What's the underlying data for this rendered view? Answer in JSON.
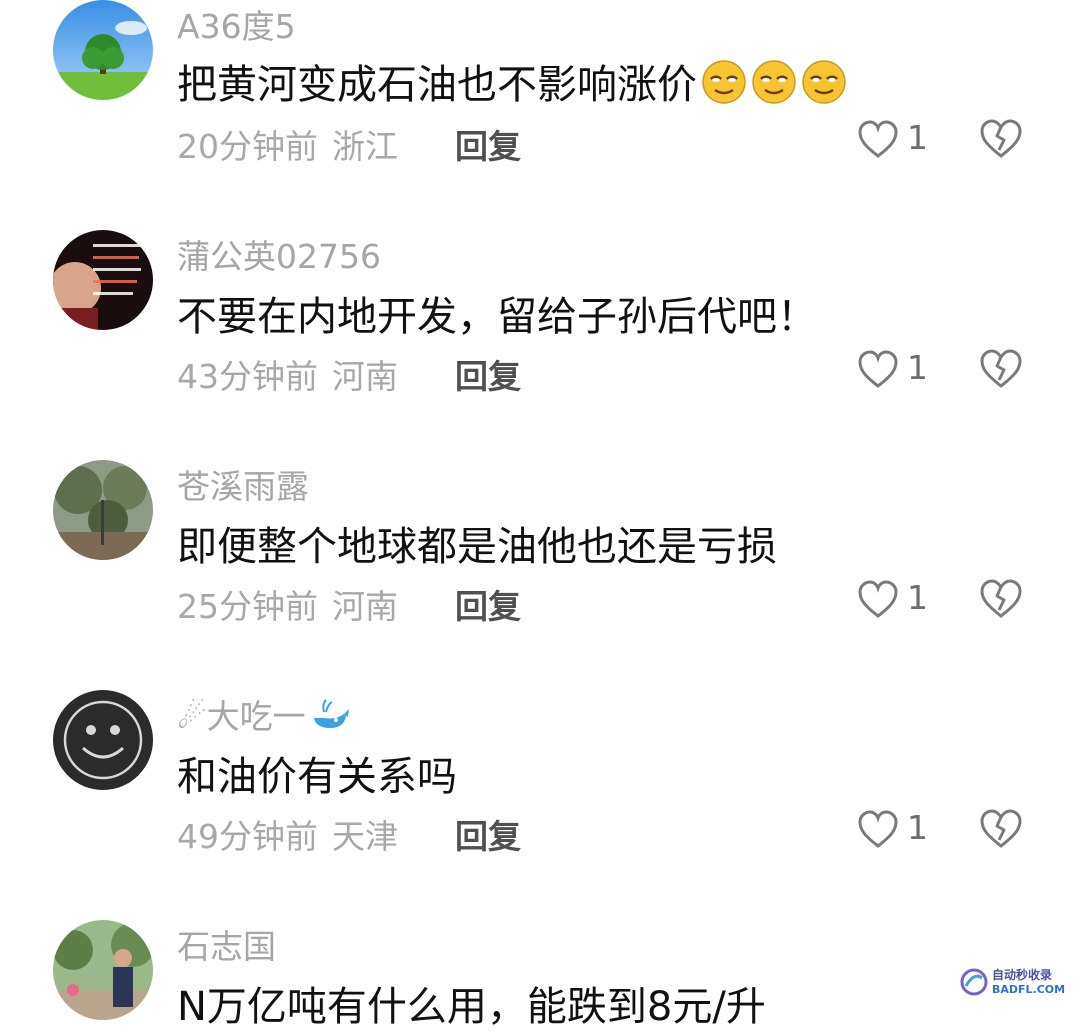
{
  "reply_label": "回复",
  "colors": {
    "username": "#a6a6a6",
    "body": "#111111",
    "meta": "#a8a8a8"
  },
  "comments": [
    {
      "username": "A36度5",
      "text": "把黄河变成石油也不影响涨价",
      "emoji": [
        "smirk-emoji",
        "smirk-emoji",
        "smirk-emoji"
      ],
      "time": "20分钟前",
      "location": "浙江",
      "likes": "1",
      "avatar": "tree-landscape"
    },
    {
      "username": "蒲公英02756",
      "text": "不要在内地开发，留给子孙后代吧！",
      "time": "43分钟前",
      "location": "河南",
      "likes": "1",
      "avatar": "person-with-text"
    },
    {
      "username": "苍溪雨露",
      "text": "即便整个地球都是油他也还是亏损",
      "time": "25分钟前",
      "location": "河南",
      "likes": "1",
      "avatar": "garden-photo"
    },
    {
      "username_prefix": "☄",
      "username": "大吃一",
      "username_suffix_icon": "whale-icon",
      "text": "和油价有关系吗",
      "time": "49分钟前",
      "location": "天津",
      "likes": "1",
      "avatar": "smiley-chalk"
    },
    {
      "username": "石志国",
      "text": "N万亿吨有什么用，能跌到8元/升",
      "avatar": "person-outdoor"
    }
  ],
  "watermark": {
    "line1": "自动秒收录",
    "line2": "BADFL.COM"
  }
}
